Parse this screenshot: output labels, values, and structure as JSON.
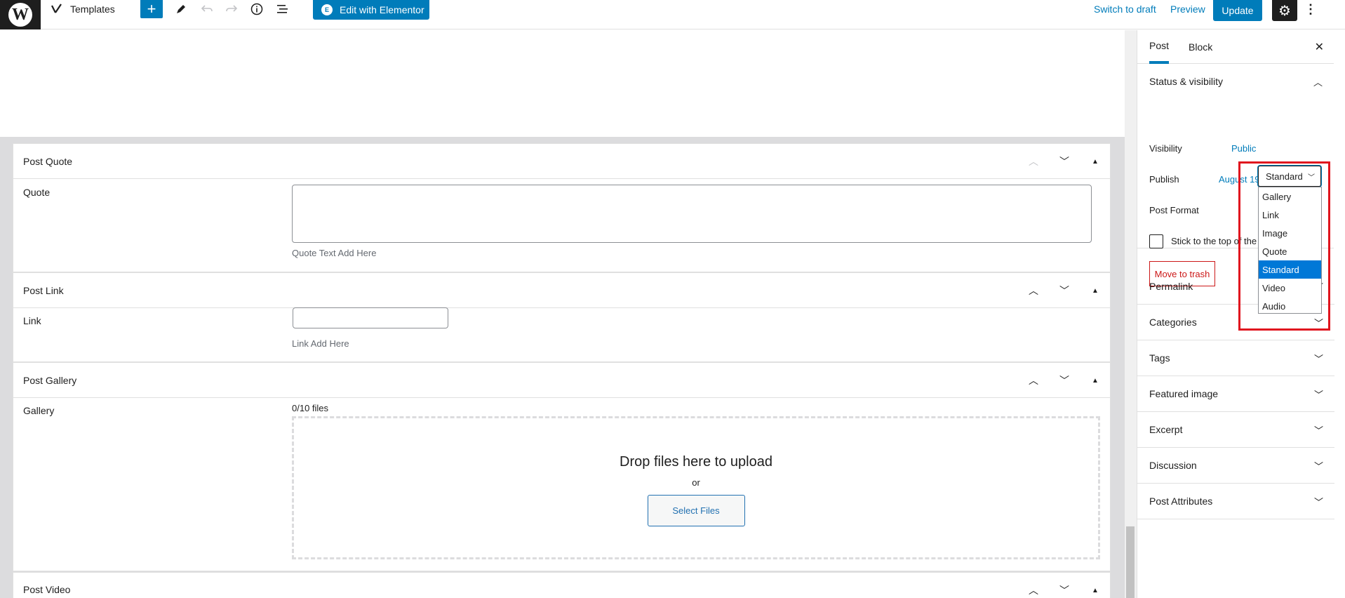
{
  "toolbar": {
    "logo_glyph": "W",
    "templates_icon": "yoast-icon",
    "templates_label": "Templates",
    "add_label": "+",
    "edit_elementor_label": "Edit with Elementor",
    "elementor_badge": "E",
    "switch_to_draft_label": "Switch to draft",
    "preview_label": "Preview",
    "update_label": "Update"
  },
  "metaboxes": {
    "quote": {
      "title": "Post Quote",
      "field_label": "Quote",
      "description": "Quote Text Add Here"
    },
    "link": {
      "title": "Post Link",
      "field_label": "Link",
      "input_value": "",
      "description": "Link Add Here"
    },
    "gallery": {
      "title": "Post Gallery",
      "field_label": "Gallery",
      "file_count": "0/10 files",
      "drop_title": "Drop files here to upload",
      "drop_or": "or",
      "select_files_label": "Select Files"
    },
    "video": {
      "title": "Post Video"
    }
  },
  "sidebar": {
    "tabs": [
      {
        "label": "Post",
        "active": true
      },
      {
        "label": "Block",
        "active": false
      }
    ],
    "status_visibility": {
      "title": "Status & visibility",
      "visibility_label": "Visibility",
      "visibility_value": "Public",
      "publish_label": "Publish",
      "publish_value": "August 19, 2020 8:26 am",
      "post_format_label": "Post Format",
      "post_format_value": "Standard",
      "sticky_label": "Stick to the top of the",
      "trash_label": "Move to trash"
    },
    "post_format_options": [
      "Gallery",
      "Link",
      "Image",
      "Quote",
      "Standard",
      "Video",
      "Audio"
    ],
    "panels": [
      {
        "title": "Permalink"
      },
      {
        "title": "Categories"
      },
      {
        "title": "Tags"
      },
      {
        "title": "Featured image"
      },
      {
        "title": "Excerpt"
      },
      {
        "title": "Discussion"
      },
      {
        "title": "Post Attributes"
      }
    ]
  },
  "colors": {
    "accent": "#007cba",
    "highlight_box": "#e0141e",
    "selected_option": "#0078d7"
  }
}
